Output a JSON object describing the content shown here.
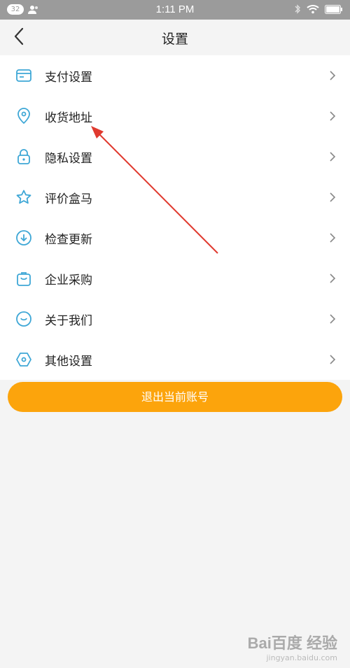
{
  "status": {
    "notif_count": "32",
    "time": "1:11 PM"
  },
  "header": {
    "title": "设置"
  },
  "settings": {
    "items": [
      {
        "label": "支付设置",
        "icon": "card-icon"
      },
      {
        "label": "收货地址",
        "icon": "location-pin-icon"
      },
      {
        "label": "隐私设置",
        "icon": "lock-icon"
      },
      {
        "label": "评价盒马",
        "icon": "star-icon"
      },
      {
        "label": "检查更新",
        "icon": "download-circle-icon"
      },
      {
        "label": "企业采购",
        "icon": "shopping-bag-icon"
      },
      {
        "label": "关于我们",
        "icon": "smile-icon"
      },
      {
        "label": "其他设置",
        "icon": "hexagon-icon"
      }
    ]
  },
  "logout": {
    "label": "退出当前账号"
  },
  "watermark": {
    "brand": "Bai百度 经验",
    "url": "jingyan.baidu.com"
  },
  "colors": {
    "accent": "#fca40c",
    "icon": "#3ea7d6",
    "annotation": "#e03a2f"
  }
}
